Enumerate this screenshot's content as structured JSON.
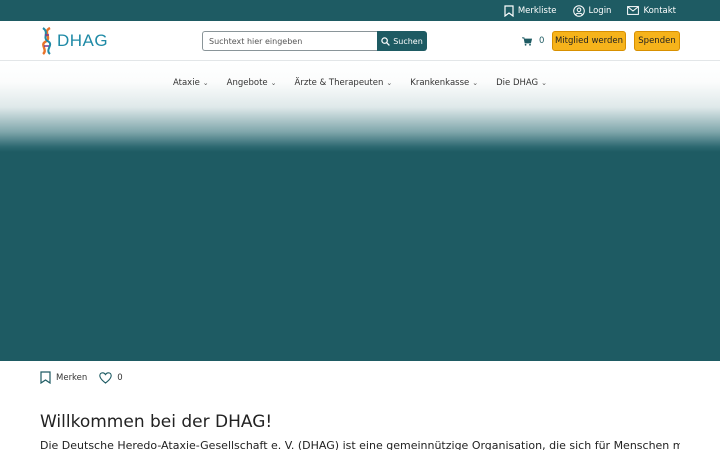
{
  "topbar": {
    "bookmarks_label": "Merkliste",
    "login_label": "Login",
    "contact_label": "Kontakt"
  },
  "header": {
    "logo_text": "DHAG",
    "search": {
      "placeholder": "Suchtext hier eingeben",
      "value": "",
      "button_label": "Suchen"
    },
    "cart_count": "0",
    "member_button": "Mitglied werden",
    "donate_button": "Spenden"
  },
  "nav": {
    "items": [
      {
        "label": "Ataxie"
      },
      {
        "label": "Angebote"
      },
      {
        "label": "Ärzte & Therapeuten"
      },
      {
        "label": "Krankenkasse"
      },
      {
        "label": "Die DHAG"
      }
    ]
  },
  "actions": {
    "bookmark_label": "Merken",
    "like_count": "0"
  },
  "content": {
    "title": "Willkommen bei der DHAG!",
    "intro": "Die Deutsche Heredo-Ataxie-Gesellschaft e. V. (DHAG) ist eine gemeinnützige Organisation, die sich für Menschen mit der seltenen"
  },
  "colors": {
    "brand_dark": "#1e5b63",
    "accent": "#f6b31b",
    "logo_blue": "#1f8aa6"
  },
  "icons": [
    "bookmark-icon",
    "user-icon",
    "mail-icon",
    "magnifier-icon",
    "cart-icon",
    "chevron-down-icon",
    "heart-icon"
  ]
}
